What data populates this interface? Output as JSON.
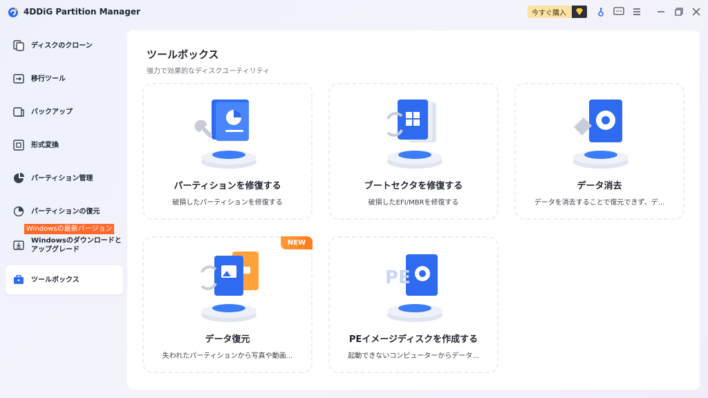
{
  "app": {
    "title": "4DDiG Partition Manager"
  },
  "titlebar": {
    "buy_label": "今すぐ購入"
  },
  "sidebar": {
    "items": [
      {
        "label": "ディスクのクローン",
        "icon": "disk-clone-icon"
      },
      {
        "label": "移行ツール",
        "icon": "migrate-icon"
      },
      {
        "label": "バックアップ",
        "icon": "backup-icon"
      },
      {
        "label": "形式変換",
        "icon": "convert-icon"
      },
      {
        "label": "パーティション管理",
        "icon": "pie-chart-icon"
      },
      {
        "label": "パーティションの復元",
        "icon": "partition-restore-icon"
      },
      {
        "label_line1": "Windowsのダウンロードと",
        "label_line2": "アップグレード",
        "badge": "Windowsの最新バージョン",
        "icon": "windows-download-icon"
      },
      {
        "label": "ツールボックス",
        "icon": "toolbox-icon",
        "active": true
      }
    ]
  },
  "main": {
    "title": "ツールボックス",
    "subtitle": "強力で効果的なディスクユーティリティ",
    "cards": [
      {
        "title": "パーティションを修復する",
        "desc": "破損したパーティションを修復する"
      },
      {
        "title": "ブートセクタを修復する",
        "desc": "破損したEFI/MBRを修復する"
      },
      {
        "title": "データ消去",
        "desc": "データを消去することで復元できず、デ..."
      },
      {
        "title": "データ復元",
        "desc": "失われたパーティションから写真や動画...",
        "badge": "NEW"
      },
      {
        "title": "PEイメージディスクを作成する",
        "desc": "起動できないコンピューターからデータ...",
        "illus_text": "PE"
      }
    ]
  },
  "colors": {
    "accent": "#2f6bf0",
    "badge_orange": "#ff6a2b",
    "buy_bg": "#fbe3a6"
  }
}
